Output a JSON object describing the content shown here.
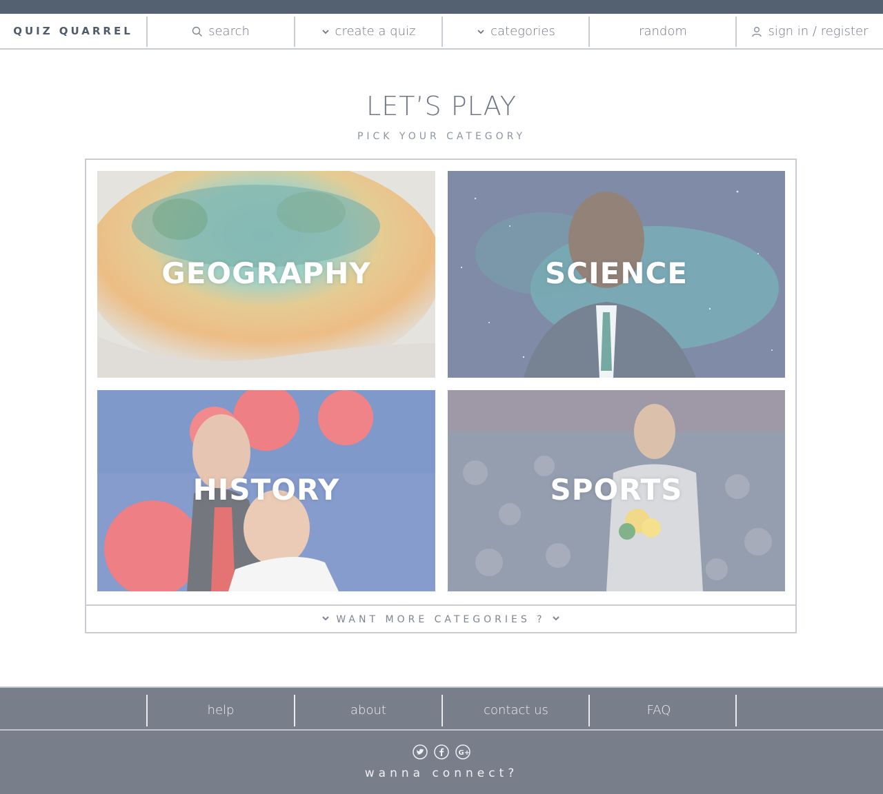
{
  "brand": "QUIZ QUARREL",
  "nav": {
    "search": "search",
    "create": "create a quiz",
    "categories": "categories",
    "random": "random",
    "signin": "sign in / register"
  },
  "hero": {
    "title": "LET’S PLAY",
    "subtitle": "PICK YOUR CATEGORY"
  },
  "tiles": [
    {
      "label": "GEOGRAPHY"
    },
    {
      "label": "SCIENCE"
    },
    {
      "label": "HISTORY"
    },
    {
      "label": "SPORTS"
    }
  ],
  "more": "WANT MORE CATEGORIES ?",
  "footer": {
    "links": [
      "help",
      "about",
      "contact us",
      "FAQ"
    ],
    "connect": "wanna connect?",
    "social": [
      "twitter-icon",
      "facebook-icon",
      "google-plus-icon"
    ]
  },
  "colors": {
    "header": "#536170",
    "footer": "#787e8a",
    "text": "#707785"
  }
}
